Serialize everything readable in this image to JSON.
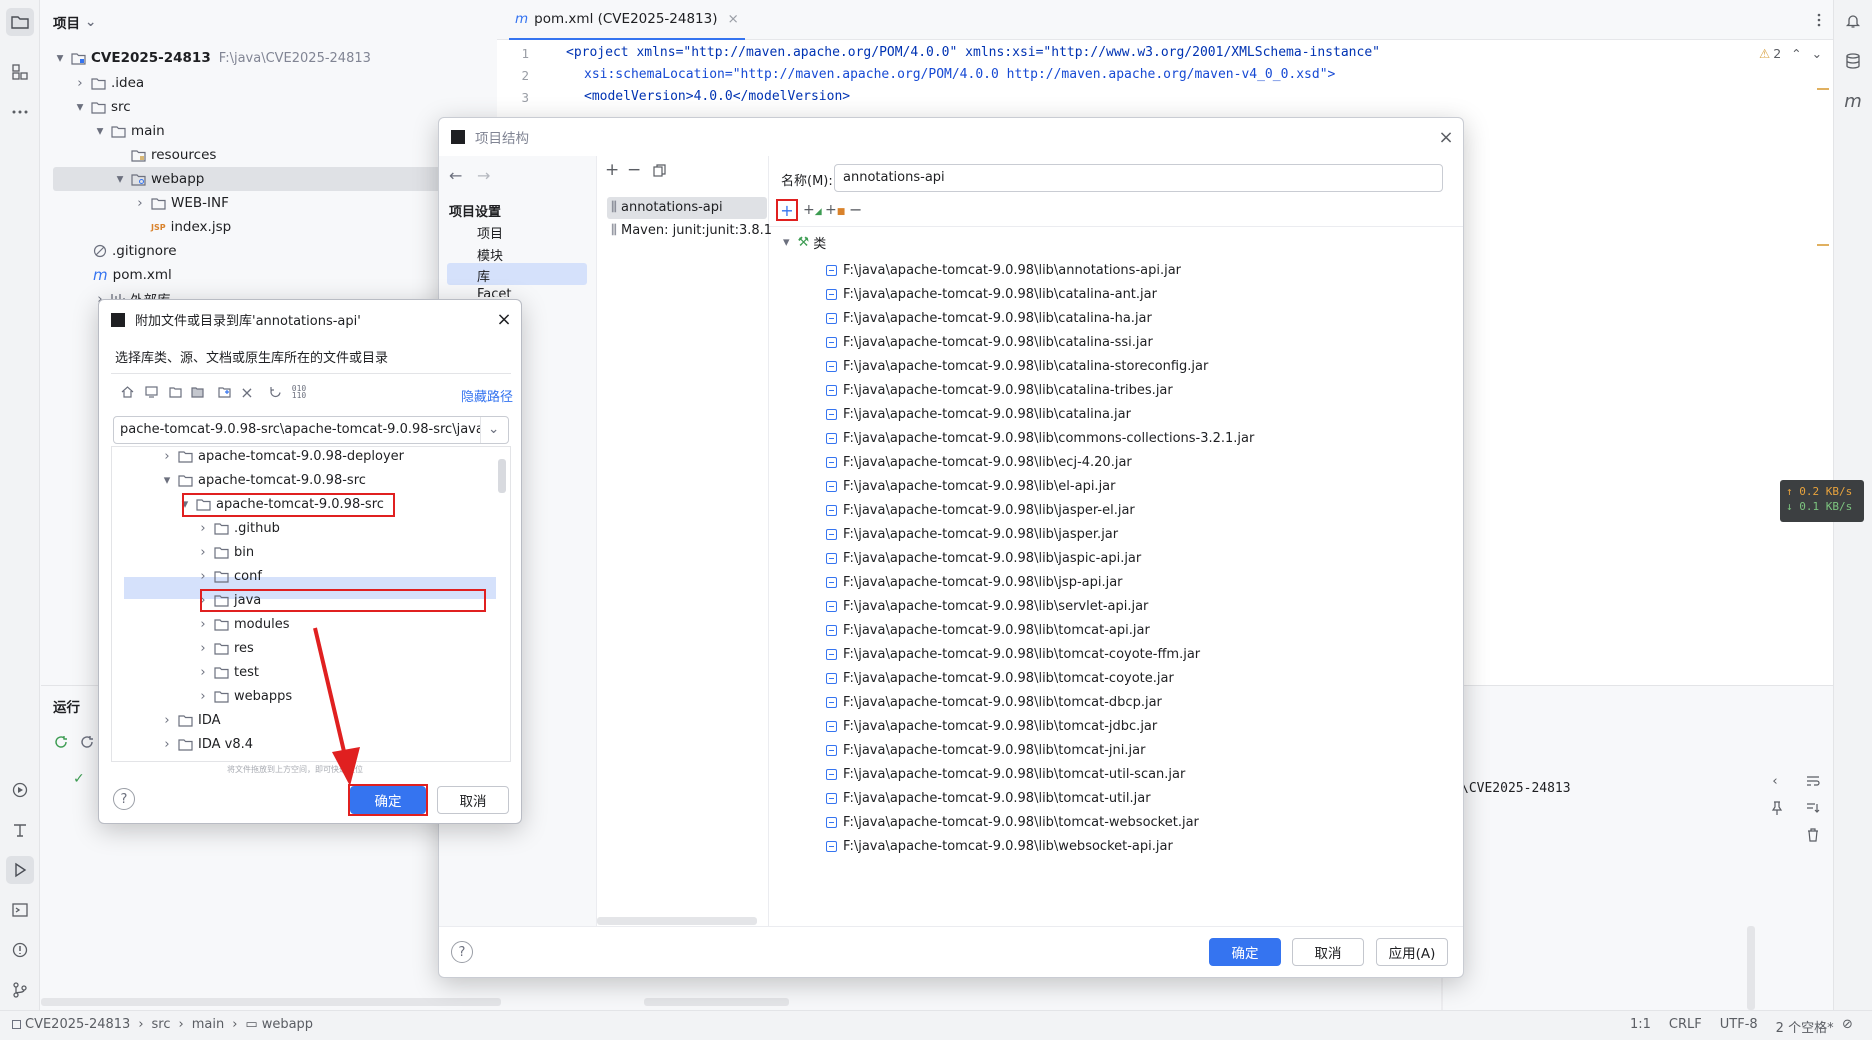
{
  "project_panel": {
    "title": "项目",
    "tree": [
      {
        "label": "CVE2025-24813",
        "path": "F:\\java\\CVE2025-24813"
      },
      {
        "label": ".idea"
      },
      {
        "label": "src"
      },
      {
        "label": "main"
      },
      {
        "label": "resources"
      },
      {
        "label": "webapp"
      },
      {
        "label": "WEB-INF"
      },
      {
        "label": "index.jsp"
      },
      {
        "label": ".gitignore"
      },
      {
        "label": "pom.xml"
      },
      {
        "label": "外部库"
      }
    ]
  },
  "editor": {
    "tab_label": "pom.xml (CVE2025-24813)",
    "warnings_count": "2",
    "lines": [
      {
        "num": "1",
        "text": "<project xmlns=\"http://maven.apache.org/POM/4.0.0\" xmlns:xsi=\"http://www.w3.org/2001/XMLSchema-instance\""
      },
      {
        "num": "2",
        "text": "xsi:schemaLocation=\"http://maven.apache.org/POM/4.0.0 http://maven.apache.org/maven-v4_0_0.xsd\">"
      },
      {
        "num": "3",
        "text": "<modelVersion>4.0.0</modelVersion>"
      }
    ]
  },
  "run_panel": {
    "title": "运行",
    "output_tail": "\\CVE2025-24813"
  },
  "network_widget": {
    "up": "↑ 0.2 KB/s",
    "down": "↓ 0.1 KB/s"
  },
  "status_bar": {
    "breadcrumb": [
      "CVE2025-24813",
      "src",
      "main",
      "webapp"
    ],
    "position": "1:1",
    "line_sep": "CRLF",
    "encoding": "UTF-8",
    "indent": "2 个空格*"
  },
  "project_structure": {
    "title": "项目结构",
    "nav_section": "项目设置",
    "nav_items": [
      "项目",
      "模块",
      "库",
      "Facet"
    ],
    "libraries": [
      "annotations-api",
      "Maven: junit:junit:3.8.1"
    ],
    "name_label": "名称(M):",
    "name_value": "annotations-api",
    "classes_node": "类",
    "jars": [
      "F:\\java\\apache-tomcat-9.0.98\\lib\\annotations-api.jar",
      "F:\\java\\apache-tomcat-9.0.98\\lib\\catalina-ant.jar",
      "F:\\java\\apache-tomcat-9.0.98\\lib\\catalina-ha.jar",
      "F:\\java\\apache-tomcat-9.0.98\\lib\\catalina-ssi.jar",
      "F:\\java\\apache-tomcat-9.0.98\\lib\\catalina-storeconfig.jar",
      "F:\\java\\apache-tomcat-9.0.98\\lib\\catalina-tribes.jar",
      "F:\\java\\apache-tomcat-9.0.98\\lib\\catalina.jar",
      "F:\\java\\apache-tomcat-9.0.98\\lib\\commons-collections-3.2.1.jar",
      "F:\\java\\apache-tomcat-9.0.98\\lib\\ecj-4.20.jar",
      "F:\\java\\apache-tomcat-9.0.98\\lib\\el-api.jar",
      "F:\\java\\apache-tomcat-9.0.98\\lib\\jasper-el.jar",
      "F:\\java\\apache-tomcat-9.0.98\\lib\\jasper.jar",
      "F:\\java\\apache-tomcat-9.0.98\\lib\\jaspic-api.jar",
      "F:\\java\\apache-tomcat-9.0.98\\lib\\jsp-api.jar",
      "F:\\java\\apache-tomcat-9.0.98\\lib\\servlet-api.jar",
      "F:\\java\\apache-tomcat-9.0.98\\lib\\tomcat-api.jar",
      "F:\\java\\apache-tomcat-9.0.98\\lib\\tomcat-coyote-ffm.jar",
      "F:\\java\\apache-tomcat-9.0.98\\lib\\tomcat-coyote.jar",
      "F:\\java\\apache-tomcat-9.0.98\\lib\\tomcat-dbcp.jar",
      "F:\\java\\apache-tomcat-9.0.98\\lib\\tomcat-jdbc.jar",
      "F:\\java\\apache-tomcat-9.0.98\\lib\\tomcat-jni.jar",
      "F:\\java\\apache-tomcat-9.0.98\\lib\\tomcat-util-scan.jar",
      "F:\\java\\apache-tomcat-9.0.98\\lib\\tomcat-util.jar",
      "F:\\java\\apache-tomcat-9.0.98\\lib\\tomcat-websocket.jar",
      "F:\\java\\apache-tomcat-9.0.98\\lib\\websocket-api.jar"
    ],
    "ok": "确定",
    "cancel": "取消",
    "apply": "应用(A)"
  },
  "attach_dialog": {
    "title": "附加文件或目录到库'annotations-api'",
    "subtitle": "选择库类、源、文档或原生库所在的文件或目录",
    "hide_path": "隐藏路径",
    "path_value": "pache-tomcat-9.0.98-src\\apache-tomcat-9.0.98-src\\java",
    "tree": [
      "apache-tomcat-9.0.98-deployer",
      "apache-tomcat-9.0.98-src",
      "apache-tomcat-9.0.98-src",
      ".github",
      "bin",
      "conf",
      "java",
      "modules",
      "res",
      "test",
      "webapps",
      "IDA",
      "IDA v8.4"
    ],
    "drop_hint": "将文件拖放到上方空间，即可快速定位",
    "ok": "确定",
    "cancel": "取消"
  },
  "colors": {
    "accent": "#3574f0",
    "highlight": "#e02020",
    "selection": "#d5e1fb"
  }
}
